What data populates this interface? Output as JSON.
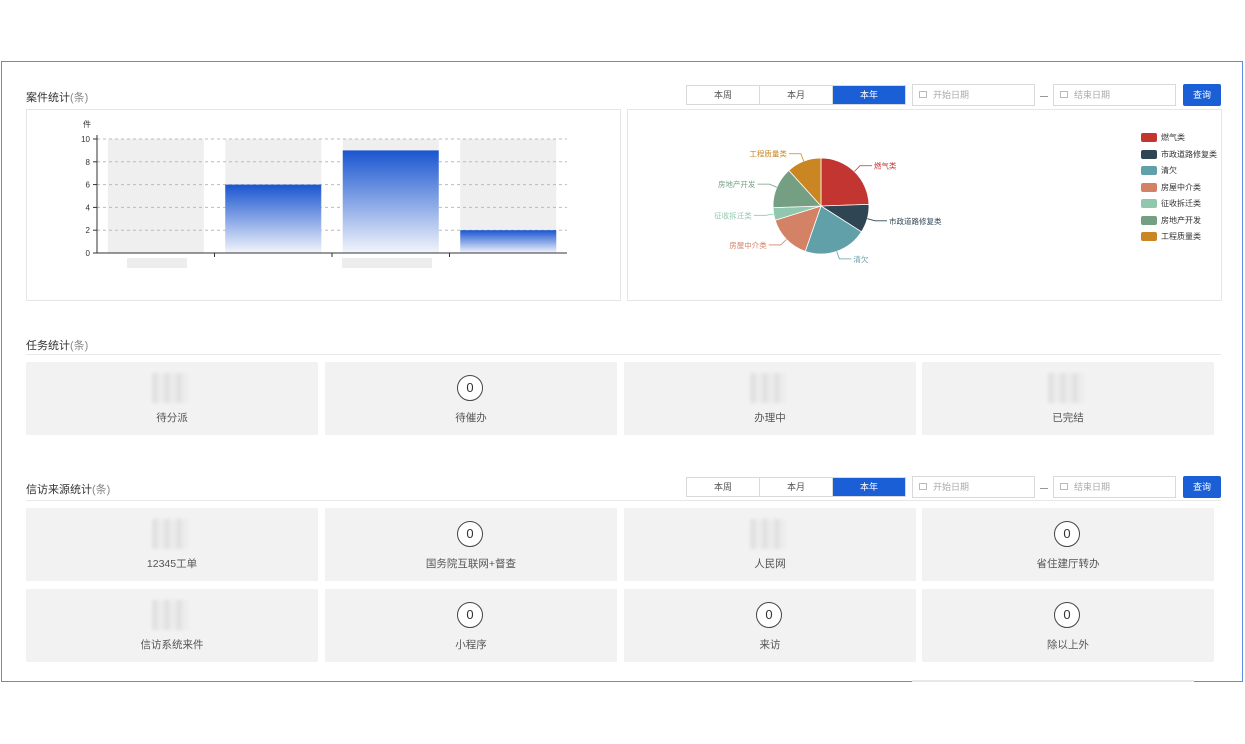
{
  "case_stats": {
    "title": "案件统计",
    "unit": "(条)",
    "tabs": [
      "本周",
      "本月",
      "本年"
    ],
    "active_tab": 2,
    "start_placeholder": "开始日期",
    "end_placeholder": "结束日期",
    "query_label": "查询"
  },
  "bar_chart": {
    "y_unit": "件",
    "y_ticks": [
      "0",
      "2",
      "4",
      "6",
      "8",
      "10"
    ]
  },
  "chart_data": [
    {
      "type": "bar",
      "ylabel": "件",
      "ylim": [
        0,
        10
      ],
      "grid": true,
      "categories": [
        "",
        "",
        "",
        ""
      ],
      "values": [
        0,
        6,
        9,
        2
      ]
    },
    {
      "type": "pie",
      "legend_position": "right",
      "slices": [
        {
          "name": "燃气类",
          "value": 23,
          "color": "#c23531"
        },
        {
          "name": "市政道路修复类",
          "value": 9,
          "color": "#2f4554"
        },
        {
          "name": "清欠",
          "value": 20,
          "color": "#61a0a8"
        },
        {
          "name": "房屋中介类",
          "value": 14,
          "color": "#d48265"
        },
        {
          "name": "征收拆迁类",
          "value": 4,
          "color": "#91c7ae"
        },
        {
          "name": "房地产开发",
          "value": 13,
          "color": "#749f83"
        },
        {
          "name": "工程质量类",
          "value": 11,
          "color": "#ca8622"
        }
      ]
    }
  ],
  "task_stats": {
    "title": "任务统计",
    "unit": "(条)",
    "cards": [
      {
        "label": "待分派",
        "value": "",
        "masked": true
      },
      {
        "label": "待催办",
        "value": "0",
        "masked": false
      },
      {
        "label": "办理中",
        "value": "",
        "masked": true
      },
      {
        "label": "已完结",
        "value": "",
        "masked": true
      }
    ]
  },
  "source_stats": {
    "title": "信访来源统计",
    "unit": "(条)",
    "tabs": [
      "本周",
      "本月",
      "本年"
    ],
    "active_tab": 2,
    "start_placeholder": "开始日期",
    "end_placeholder": "结束日期",
    "query_label": "查询",
    "cards": [
      {
        "label": "12345工单",
        "value": "",
        "masked": true
      },
      {
        "label": "国务院互联网+督查",
        "value": "0",
        "masked": false
      },
      {
        "label": "人民网",
        "value": "",
        "masked": true
      },
      {
        "label": "省住建厅转办",
        "value": "0",
        "masked": false
      },
      {
        "label": "信访系统来件",
        "value": "",
        "masked": true
      },
      {
        "label": "小程序",
        "value": "0",
        "masked": false
      },
      {
        "label": "来访",
        "value": "0",
        "masked": false
      },
      {
        "label": "除以上外",
        "value": "0",
        "masked": false
      }
    ]
  }
}
